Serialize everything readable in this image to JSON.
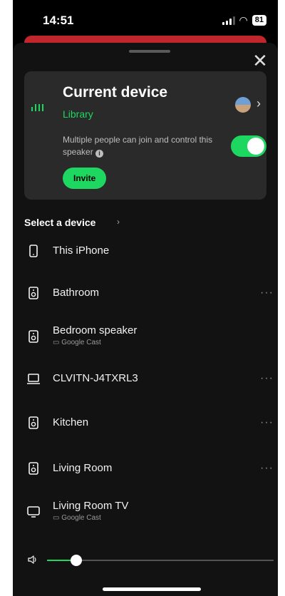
{
  "status": {
    "time": "14:51",
    "battery": "81"
  },
  "sheet": {
    "close_icon": "close-icon"
  },
  "current_device": {
    "title": "Current device",
    "source": "Library",
    "description": "Multiple people can join and control this speaker",
    "toggle_on": true,
    "invite_label": "Invite",
    "accent": "#1ed760"
  },
  "devices_header": "Select a device",
  "devices": [
    {
      "name": "This iPhone",
      "icon": "phone-icon",
      "cast": "",
      "more": false
    },
    {
      "name": "Bathroom",
      "icon": "speaker-icon",
      "cast": "",
      "more": true
    },
    {
      "name": "Bedroom speaker",
      "icon": "speaker-icon",
      "cast": "Google Cast",
      "more": false
    },
    {
      "name": "CLVITN-J4TXRL3",
      "icon": "laptop-icon",
      "cast": "",
      "more": true
    },
    {
      "name": "Kitchen",
      "icon": "speaker-icon",
      "cast": "",
      "more": true
    },
    {
      "name": "Living Room",
      "icon": "speaker-icon",
      "cast": "",
      "more": true
    },
    {
      "name": "Living Room TV",
      "icon": "tv-icon",
      "cast": "Google Cast",
      "more": false
    }
  ],
  "volume": {
    "level": 0.13
  }
}
